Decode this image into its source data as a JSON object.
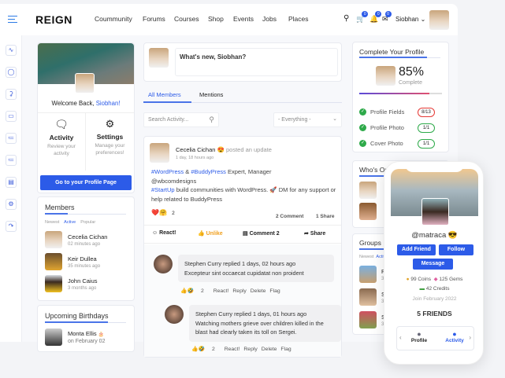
{
  "header": {
    "logo": "REIGN",
    "nav": [
      "Coummunity",
      "Forums",
      "Courses",
      "Shop",
      "Events",
      "Jobs",
      "Places"
    ],
    "cart_count": "0",
    "notif_count": "0",
    "msg_count": "0",
    "user": "Siobhan"
  },
  "sidebar_icons": [
    "chart-icon",
    "user-icon",
    "bell-icon",
    "inbox-icon",
    "groups-icon",
    "members-icon",
    "calendar-icon",
    "settings-icon",
    "logout-icon"
  ],
  "welcome": {
    "prefix": "Welcome Back, ",
    "name": "Siobhan!",
    "activity_title": "Activity",
    "activity_desc": "Review your activity",
    "settings_title": "Settings",
    "settings_desc": "Manage your preferences!",
    "profile_button": "Go to your Profile Page"
  },
  "members": {
    "title": "Members",
    "tabs": [
      "Newest",
      "Active",
      "Popular"
    ],
    "items": [
      {
        "name": "Cecelia Cichan",
        "time": "02 minutes ago"
      },
      {
        "name": "Keir Dullea",
        "time": "35 minutes ago"
      },
      {
        "name": "John Caius",
        "time": "3 months ago"
      }
    ]
  },
  "birthdays": {
    "title": "Upcoming Birthdays",
    "items": [
      {
        "name": "Monta Ellis",
        "date": "on February 02",
        "emoji": "🎂"
      }
    ]
  },
  "composer": {
    "placeholder": "What's new, Siobhan?"
  },
  "tabs": [
    "All Members",
    "Mentions"
  ],
  "filter": {
    "search_placeholder": "Search Activity...",
    "select": "- Everything -"
  },
  "post": {
    "author": "Cecelia Cichan",
    "emoji": "😍",
    "action": "posted an update",
    "time": "1 day, 18 hours ago",
    "tag1": "#WordPress",
    "amp": " & ",
    "tag2": "#BuddyPress",
    "line1": " Expert, Manager",
    "line2": "@wbcomdesigns",
    "tag3": "#StartUp",
    "line3": " build communities with WordPress. 🚀 DM for any support or help related to BuddyPress",
    "reactions": "❤️🤗",
    "reaction_count": "2",
    "comments": "2 Comment",
    "shares": "1 Share",
    "actions": [
      "React!",
      "Unlike",
      "Comment 2",
      "Share"
    ]
  },
  "comments": [
    {
      "header": "Stephen Curry replied 1 days, 02 hours ago",
      "text": "Excepteur sint occaecat cupidatat non proident",
      "reactions": "👍🤣",
      "count": "2",
      "actions": [
        "React!",
        "Reply",
        "Delete",
        "Flag"
      ]
    },
    {
      "header": "Stephen Curry replied 1 days, 01 hours ago",
      "text": "Watching mothers grieve over children killed in the blast had clearly taken its toll on Sergei.",
      "reactions": "👍🤣",
      "count": "2",
      "actions": [
        "React!",
        "Reply",
        "Delete",
        "Flag"
      ]
    }
  ],
  "complete_profile": {
    "title": "Complete Your Profile",
    "percent": "85%",
    "percent_value": 85,
    "label": "Complete",
    "items": [
      {
        "label": "Profile Fields",
        "value": "8/13",
        "status": "#e53935"
      },
      {
        "label": "Profile Photo",
        "value": "1/1",
        "status": "#2eaa4a"
      },
      {
        "label": "Cover Photo",
        "value": "1/1",
        "status": "#2eaa4a"
      }
    ]
  },
  "whos_online": {
    "title": "Who's Online"
  },
  "groups": {
    "title": "Groups",
    "tabs": [
      "Newest",
      "Active"
    ],
    "items": [
      {
        "initial": "R",
        "meta": "3"
      },
      {
        "initial": "S",
        "meta": "3"
      },
      {
        "initial": "S",
        "meta": "3"
      }
    ]
  },
  "phone": {
    "handle": "@matraca",
    "emoji": "😎",
    "add_friend": "Add Friend",
    "follow": "Follow",
    "message": "Message",
    "coins": "99 Coins",
    "gems": "125 Gems",
    "credits": "42 Credits",
    "joined": "Join February 2022",
    "friends": "5 FRIENDS",
    "nav_profile": "Profile",
    "nav_activity": "Activity"
  }
}
